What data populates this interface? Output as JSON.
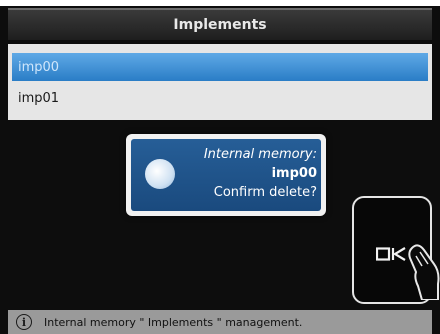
{
  "header": {
    "title": "Implements"
  },
  "list": {
    "items": [
      {
        "label": "imp00",
        "selected": true
      },
      {
        "label": "imp01",
        "selected": false
      }
    ]
  },
  "dialog": {
    "line1": "Internal memory:",
    "line2": "imp00",
    "line3": "Confirm delete?",
    "icon": "sphere-icon"
  },
  "ok_button": {
    "label": "OK",
    "icon": "touch-hand-icon"
  },
  "status": {
    "icon": "info-icon",
    "text": "Internal memory \" Implements \" management."
  },
  "colors": {
    "selection": "#2a7dc6",
    "dialog_bg": "#1f5289",
    "status_bg": "#9a9a9a"
  }
}
